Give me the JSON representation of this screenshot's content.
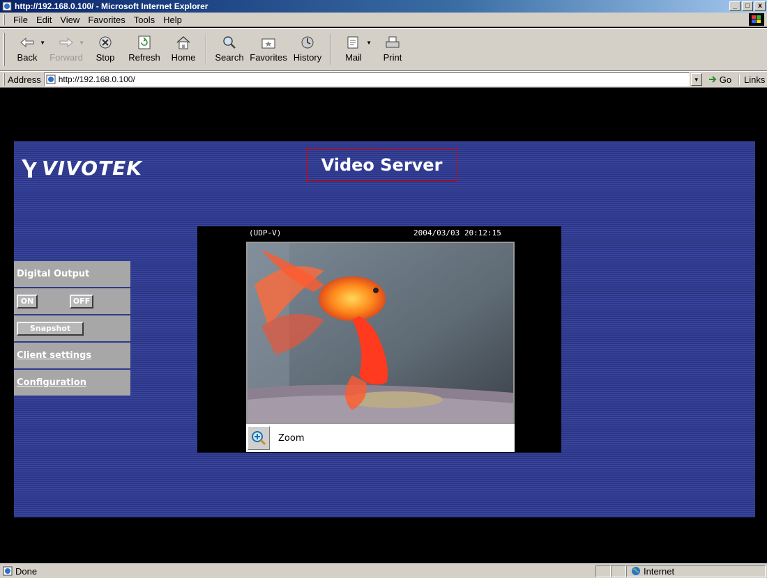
{
  "window": {
    "title": "http://192.168.0.100/ - Microsoft Internet Explorer",
    "controls": [
      "_",
      "□",
      "x"
    ]
  },
  "menu": [
    "File",
    "Edit",
    "View",
    "Favorites",
    "Tools",
    "Help"
  ],
  "toolbar": {
    "back": "Back",
    "forward": "Forward",
    "stop": "Stop",
    "refresh": "Refresh",
    "home": "Home",
    "search": "Search",
    "favorites": "Favorites",
    "history": "History",
    "mail": "Mail",
    "print": "Print"
  },
  "address": {
    "label": "Address",
    "url": "http://192.168.0.100/",
    "go": "Go",
    "links": "Links"
  },
  "page": {
    "logo": "VIVOTEK",
    "title": "Video Server",
    "sidebar": {
      "digital_output": "Digital Output",
      "on": "ON",
      "off": "OFF",
      "snapshot": "Snapshot",
      "client_settings": "Client settings",
      "configuration": "Configuration"
    },
    "video": {
      "mode": "(UDP-V)",
      "timestamp": "2004/03/03 20:12:15",
      "zoom": "Zoom"
    }
  },
  "status": {
    "text": "Done",
    "zone": "Internet"
  },
  "colors": {
    "banner": "#2e3a8c",
    "title_outline": "#e00000",
    "sidebar": "#a7a7a7"
  }
}
